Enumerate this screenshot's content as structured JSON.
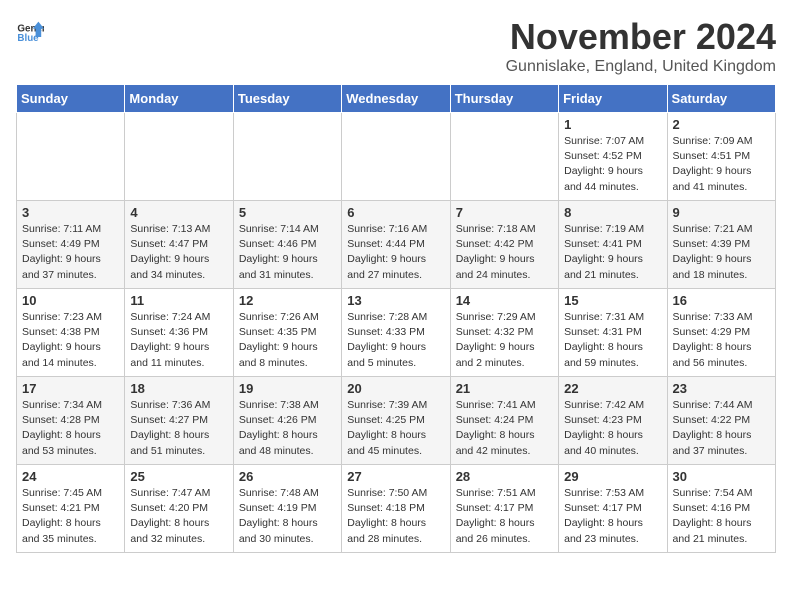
{
  "logo": {
    "general": "General",
    "blue": "Blue"
  },
  "title": {
    "month": "November 2024",
    "location": "Gunnislake, England, United Kingdom"
  },
  "days_of_week": [
    "Sunday",
    "Monday",
    "Tuesday",
    "Wednesday",
    "Thursday",
    "Friday",
    "Saturday"
  ],
  "weeks": [
    [
      {
        "day": "",
        "info": ""
      },
      {
        "day": "",
        "info": ""
      },
      {
        "day": "",
        "info": ""
      },
      {
        "day": "",
        "info": ""
      },
      {
        "day": "",
        "info": ""
      },
      {
        "day": "1",
        "info": "Sunrise: 7:07 AM\nSunset: 4:52 PM\nDaylight: 9 hours and 44 minutes."
      },
      {
        "day": "2",
        "info": "Sunrise: 7:09 AM\nSunset: 4:51 PM\nDaylight: 9 hours and 41 minutes."
      }
    ],
    [
      {
        "day": "3",
        "info": "Sunrise: 7:11 AM\nSunset: 4:49 PM\nDaylight: 9 hours and 37 minutes."
      },
      {
        "day": "4",
        "info": "Sunrise: 7:13 AM\nSunset: 4:47 PM\nDaylight: 9 hours and 34 minutes."
      },
      {
        "day": "5",
        "info": "Sunrise: 7:14 AM\nSunset: 4:46 PM\nDaylight: 9 hours and 31 minutes."
      },
      {
        "day": "6",
        "info": "Sunrise: 7:16 AM\nSunset: 4:44 PM\nDaylight: 9 hours and 27 minutes."
      },
      {
        "day": "7",
        "info": "Sunrise: 7:18 AM\nSunset: 4:42 PM\nDaylight: 9 hours and 24 minutes."
      },
      {
        "day": "8",
        "info": "Sunrise: 7:19 AM\nSunset: 4:41 PM\nDaylight: 9 hours and 21 minutes."
      },
      {
        "day": "9",
        "info": "Sunrise: 7:21 AM\nSunset: 4:39 PM\nDaylight: 9 hours and 18 minutes."
      }
    ],
    [
      {
        "day": "10",
        "info": "Sunrise: 7:23 AM\nSunset: 4:38 PM\nDaylight: 9 hours and 14 minutes."
      },
      {
        "day": "11",
        "info": "Sunrise: 7:24 AM\nSunset: 4:36 PM\nDaylight: 9 hours and 11 minutes."
      },
      {
        "day": "12",
        "info": "Sunrise: 7:26 AM\nSunset: 4:35 PM\nDaylight: 9 hours and 8 minutes."
      },
      {
        "day": "13",
        "info": "Sunrise: 7:28 AM\nSunset: 4:33 PM\nDaylight: 9 hours and 5 minutes."
      },
      {
        "day": "14",
        "info": "Sunrise: 7:29 AM\nSunset: 4:32 PM\nDaylight: 9 hours and 2 minutes."
      },
      {
        "day": "15",
        "info": "Sunrise: 7:31 AM\nSunset: 4:31 PM\nDaylight: 8 hours and 59 minutes."
      },
      {
        "day": "16",
        "info": "Sunrise: 7:33 AM\nSunset: 4:29 PM\nDaylight: 8 hours and 56 minutes."
      }
    ],
    [
      {
        "day": "17",
        "info": "Sunrise: 7:34 AM\nSunset: 4:28 PM\nDaylight: 8 hours and 53 minutes."
      },
      {
        "day": "18",
        "info": "Sunrise: 7:36 AM\nSunset: 4:27 PM\nDaylight: 8 hours and 51 minutes."
      },
      {
        "day": "19",
        "info": "Sunrise: 7:38 AM\nSunset: 4:26 PM\nDaylight: 8 hours and 48 minutes."
      },
      {
        "day": "20",
        "info": "Sunrise: 7:39 AM\nSunset: 4:25 PM\nDaylight: 8 hours and 45 minutes."
      },
      {
        "day": "21",
        "info": "Sunrise: 7:41 AM\nSunset: 4:24 PM\nDaylight: 8 hours and 42 minutes."
      },
      {
        "day": "22",
        "info": "Sunrise: 7:42 AM\nSunset: 4:23 PM\nDaylight: 8 hours and 40 minutes."
      },
      {
        "day": "23",
        "info": "Sunrise: 7:44 AM\nSunset: 4:22 PM\nDaylight: 8 hours and 37 minutes."
      }
    ],
    [
      {
        "day": "24",
        "info": "Sunrise: 7:45 AM\nSunset: 4:21 PM\nDaylight: 8 hours and 35 minutes."
      },
      {
        "day": "25",
        "info": "Sunrise: 7:47 AM\nSunset: 4:20 PM\nDaylight: 8 hours and 32 minutes."
      },
      {
        "day": "26",
        "info": "Sunrise: 7:48 AM\nSunset: 4:19 PM\nDaylight: 8 hours and 30 minutes."
      },
      {
        "day": "27",
        "info": "Sunrise: 7:50 AM\nSunset: 4:18 PM\nDaylight: 8 hours and 28 minutes."
      },
      {
        "day": "28",
        "info": "Sunrise: 7:51 AM\nSunset: 4:17 PM\nDaylight: 8 hours and 26 minutes."
      },
      {
        "day": "29",
        "info": "Sunrise: 7:53 AM\nSunset: 4:17 PM\nDaylight: 8 hours and 23 minutes."
      },
      {
        "day": "30",
        "info": "Sunrise: 7:54 AM\nSunset: 4:16 PM\nDaylight: 8 hours and 21 minutes."
      }
    ]
  ]
}
